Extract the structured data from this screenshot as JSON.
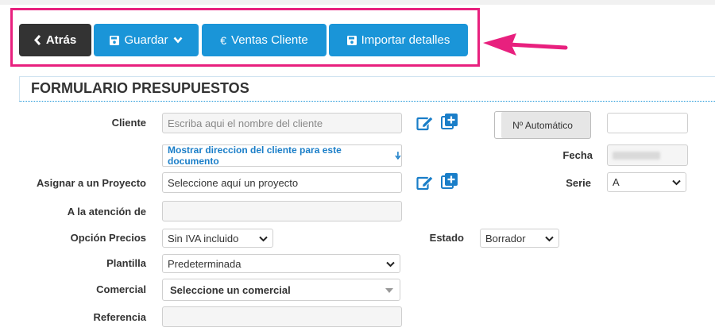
{
  "toolbar": {
    "back_label": "Atrás",
    "save_label": "Guardar",
    "sales_label": "Ventas Cliente",
    "import_label": "Importar detalles"
  },
  "section": {
    "title": "FORMULARIO PRESUPUESTOS"
  },
  "form": {
    "cliente_label": "Cliente",
    "cliente_placeholder": "Escriba aqui el nombre del cliente",
    "address_link": "Mostrar direccion del cliente para este documento",
    "proyecto_label": "Asignar a un Proyecto",
    "proyecto_value": "Seleccione aquí un proyecto",
    "atencion_label": "A la atención de",
    "opcion_label": "Opción Precios",
    "opcion_value": "Sin IVA incluido",
    "plantilla_label": "Plantilla",
    "plantilla_value": "Predeterminada",
    "comercial_label": "Comercial",
    "comercial_value": "Seleccione un comercial",
    "referencia_label": "Referencia",
    "auto_button": "Nº Automático",
    "fecha_label": "Fecha",
    "serie_label": "Serie",
    "serie_value": "A",
    "estado_label": "Estado",
    "estado_value": "Borrador"
  },
  "colors": {
    "accent": "#1a95d8",
    "highlight": "#e8207e",
    "dark_button": "#333333"
  }
}
